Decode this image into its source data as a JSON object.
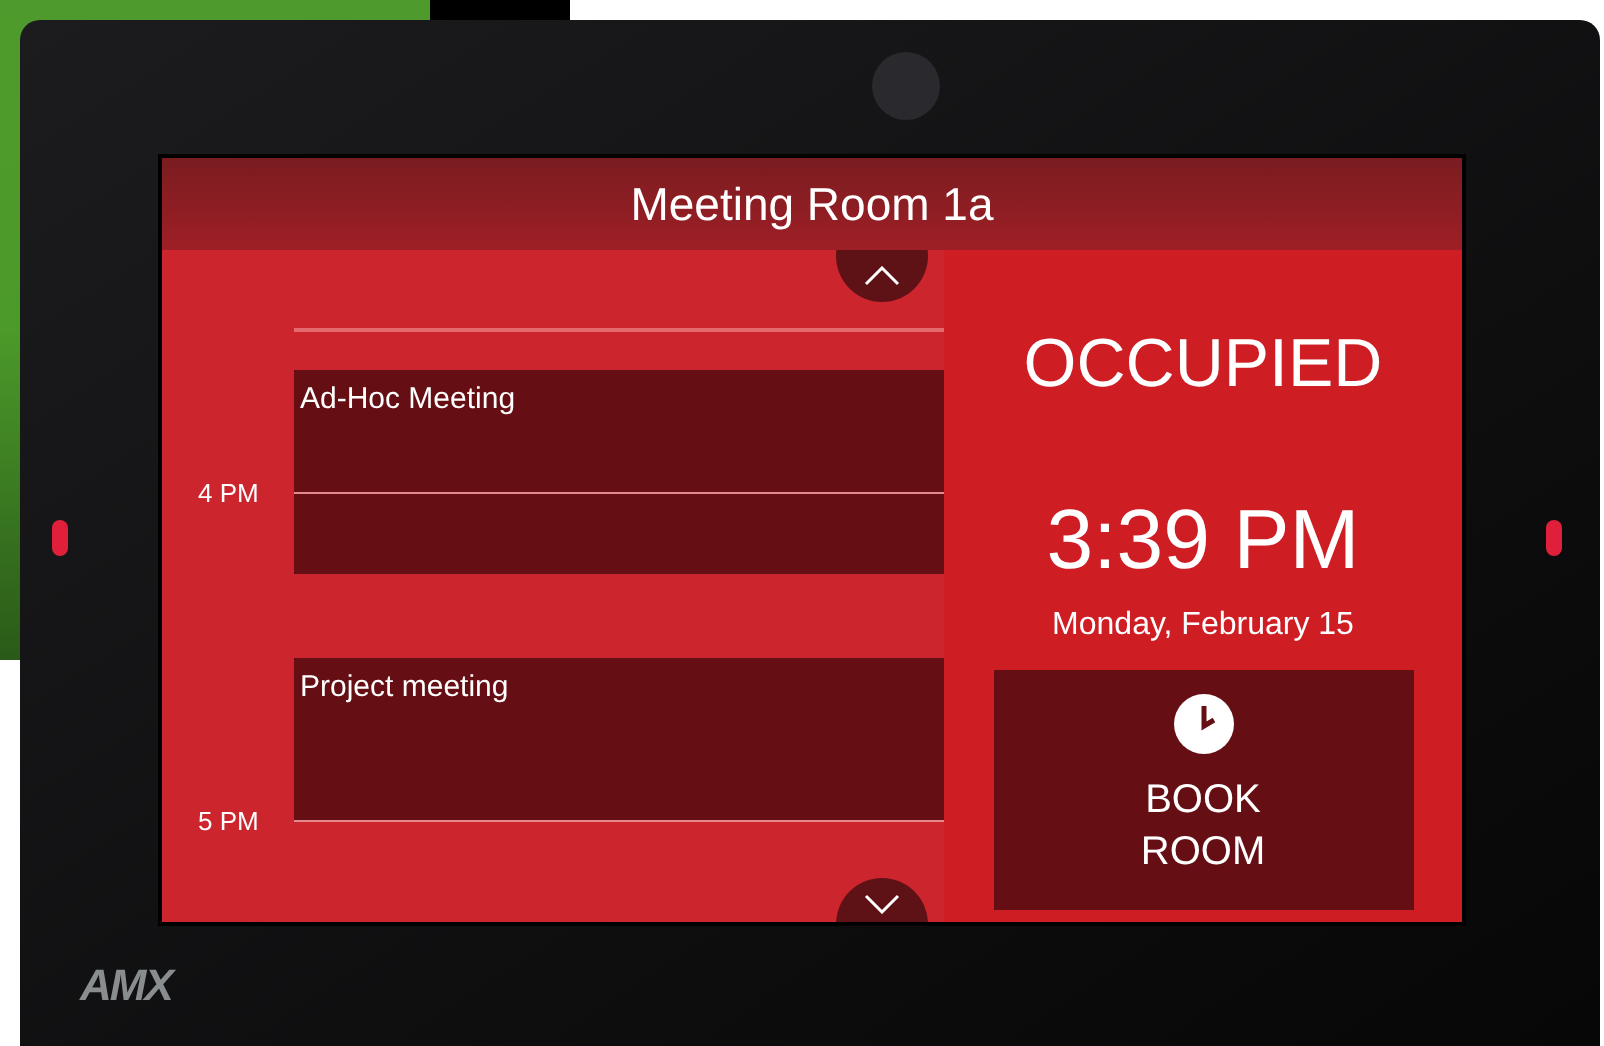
{
  "room_title": "Meeting Room 1a",
  "hours": [
    "4 PM",
    "5 PM"
  ],
  "events": [
    {
      "title": "Ad-Hoc Meeting"
    },
    {
      "title": "Project meeting"
    }
  ],
  "status": "OCCUPIED",
  "time": "3:39 PM",
  "date": "Monday, February 15",
  "book_button": "BOOK ROOM",
  "device_logo": "AMX"
}
